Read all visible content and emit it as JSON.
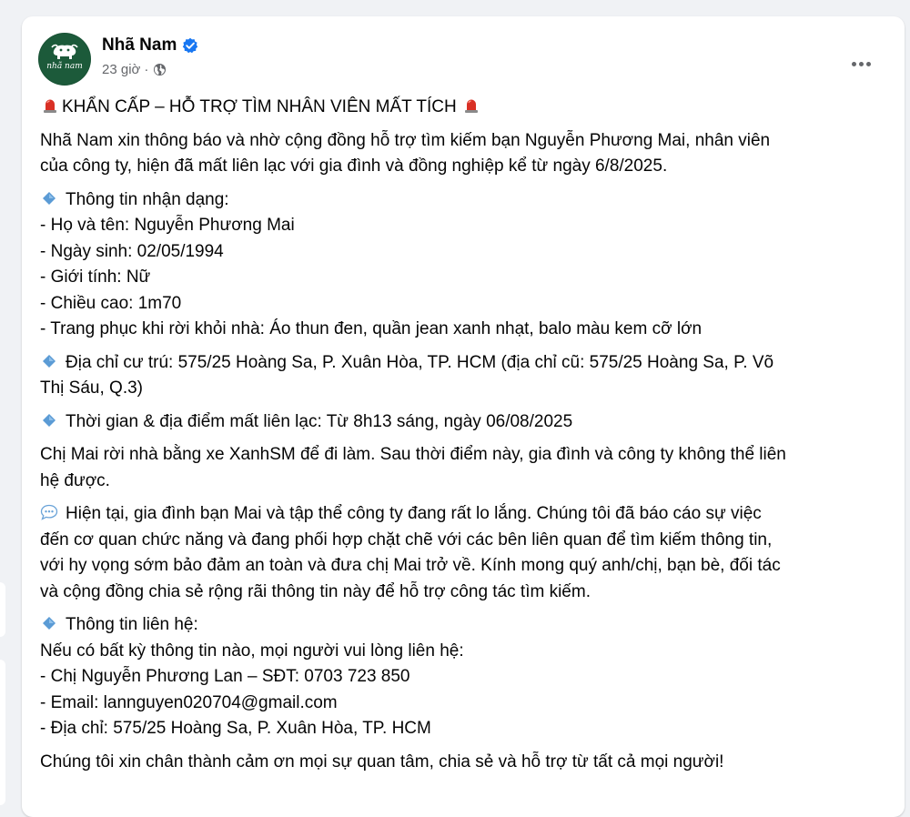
{
  "post": {
    "page_name": "Nhã Nam",
    "time_ago": "23 giờ",
    "meta_separator": "·",
    "avatar_text": "nhã nam",
    "title": "KHẨN CẤP – HỖ TRỢ TÌM NHÂN VIÊN MẤT TÍCH",
    "intro_line1": "Nhã Nam xin thông báo và nhờ cộng đồng hỗ trợ tìm kiếm bạn Nguyễn Phương Mai, nhân viên",
    "intro_line2": "của công ty, hiện đã mất liên lạc với gia đình và đồng nghiệp kể từ ngày 6/8/2025.",
    "id_heading": "Thông tin nhận dạng:",
    "id_items": [
      "- Họ và tên: Nguyễn Phương Mai",
      "- Ngày sinh: 02/05/1994",
      "- Giới tính: Nữ",
      "- Chiều cao: 1m70",
      "- Trang phục khi rời khỏi nhà: Áo thun đen, quần jean xanh nhạt, balo màu kem cỡ lớn"
    ],
    "address_line1": "Địa chỉ cư trú: 575/25 Hoàng Sa, P. Xuân Hòa, TP. HCM (địa chỉ cũ: 575/25 Hoàng Sa, P. Võ",
    "address_line2": "Thị Sáu, Q.3)",
    "lost_contact": "Thời gian & địa điểm mất liên lạc: Từ 8h13 sáng, ngày 06/08/2025",
    "leave_line1": "Chị Mai rời nhà bằng xe XanhSM để đi làm. Sau thời điểm này, gia đình và công ty không thể liên",
    "leave_line2": "hệ được.",
    "now_line1": "Hiện tại, gia đình bạn Mai và tập thể công ty đang rất lo lắng. Chúng tôi đã báo cáo sự việc",
    "now_line2": "đến cơ quan chức năng và đang phối hợp chặt chẽ với các bên liên quan để tìm kiếm thông tin,",
    "now_line3": "với hy vọng sớm bảo đảm an toàn và đưa chị Mai trở về. Kính mong quý anh/chị, bạn bè, đối tác",
    "now_line4": "và cộng đồng chia sẻ rộng rãi thông tin này để hỗ trợ công tác tìm kiếm.",
    "contact_heading": "Thông tin liên hệ:",
    "contact_items": [
      "Nếu có bất kỳ thông tin nào, mọi người vui lòng liên hệ:",
      "- Chị Nguyễn Phương Lan – SĐT: 0703 723 850",
      "- Email: lannguyen020704@gmail.com",
      "- Địa chỉ: 575/25 Hoàng Sa, P. Xuân Hòa, TP. HCM"
    ],
    "closing": "Chúng tôi xin chân thành cảm ơn mọi sự quan tâm, chia sẻ và hỗ trợ từ tất cả mọi người!"
  },
  "colors": {
    "background": "#f0f2f5",
    "card": "#ffffff",
    "text": "#050505",
    "secondary_text": "#65676b",
    "verified_blue": "#1877f2",
    "avatar_green": "#1c5a3a",
    "siren_red": "#d93025",
    "diamond_blue": "#5b9bd5"
  },
  "icons": {
    "verified": "verified-badge-icon",
    "globe": "globe-public-icon",
    "more": "more-options-icon",
    "siren": "police-siren-emoji",
    "diamond": "blue-diamond-emoji",
    "speech": "speech-bubble-emoji"
  }
}
